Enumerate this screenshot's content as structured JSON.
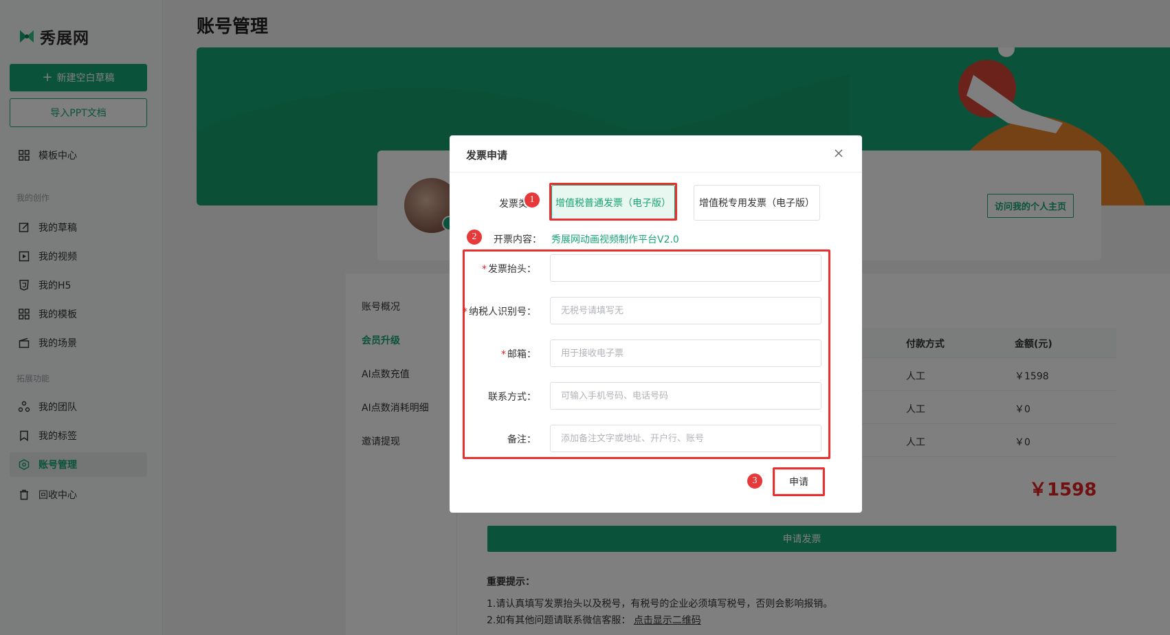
{
  "brand": {
    "name": "秀展网",
    "accent": "#17a574"
  },
  "sidebar": {
    "new_draft": "新建空白草稿",
    "import_ppt": "导入PPT文档",
    "template_center": "模板中心",
    "section_creation": "我的创作",
    "creation_items": [
      {
        "label": "我的草稿",
        "icon": "edit-icon"
      },
      {
        "label": "我的视频",
        "icon": "video-icon"
      },
      {
        "label": "我的H5",
        "icon": "html5-icon"
      },
      {
        "label": "我的模板",
        "icon": "grid-icon"
      },
      {
        "label": "我的场景",
        "icon": "scene-icon"
      }
    ],
    "section_extend": "拓展功能",
    "extend_items": [
      {
        "label": "我的团队",
        "icon": "team-icon"
      },
      {
        "label": "我的标签",
        "icon": "bookmark-icon"
      },
      {
        "label": "账号管理",
        "icon": "account-icon",
        "active": true
      },
      {
        "label": "回收中心",
        "icon": "trash-icon"
      }
    ]
  },
  "main": {
    "title": "账号管理",
    "visit_homepage": "访问我的个人主页",
    "tabs": [
      "账号概况",
      "会员升级",
      "AI点数充值",
      "AI点数消耗明细",
      "邀请提现"
    ],
    "active_tab": "会员升级",
    "table": {
      "headers": [
        "付款方式",
        "金额(元)"
      ],
      "rows": [
        [
          "人工",
          "￥1598"
        ],
        [
          "人工",
          "￥0"
        ],
        [
          "人工",
          "￥0"
        ]
      ]
    },
    "total": "￥1598",
    "apply_invoice": "申请发票",
    "notice": {
      "title": "重要提示：",
      "line1": "1.请认真填写发票抬头以及税号，有税号的企业必须填写税号，否则会影响报销。",
      "line2_prefix": "2.如有其他问题请联系微信客服：",
      "line2_link": "点击显示二维码"
    }
  },
  "modal": {
    "title": "发票申请",
    "type_label": "发票类",
    "type_options": [
      "增值税普通发票（电子版）",
      "增值税专用发票（电子版）"
    ],
    "selected_type": "增值税普通发票（电子版）",
    "content_label": "开票内容：",
    "content_value": "秀展网动画视频制作平台V2.0",
    "fields": [
      {
        "label": "发票抬头：",
        "required": true,
        "placeholder": "",
        "value": ""
      },
      {
        "label": "纳税人识别号：",
        "required": true,
        "placeholder": "无税号请填写无",
        "value": ""
      },
      {
        "label": "邮箱：",
        "required": true,
        "placeholder": "用于接收电子票",
        "value": ""
      },
      {
        "label": "联系方式：",
        "required": false,
        "placeholder": "可输入手机号码、电话号码",
        "value": ""
      },
      {
        "label": "备注：",
        "required": false,
        "placeholder": "添加备注文字或地址、开户行、账号",
        "value": ""
      }
    ],
    "submit": "申请",
    "required_mark": "*"
  },
  "annotations": {
    "step1": "1",
    "step2": "2",
    "step3": "3",
    "color": "#e8302f"
  }
}
